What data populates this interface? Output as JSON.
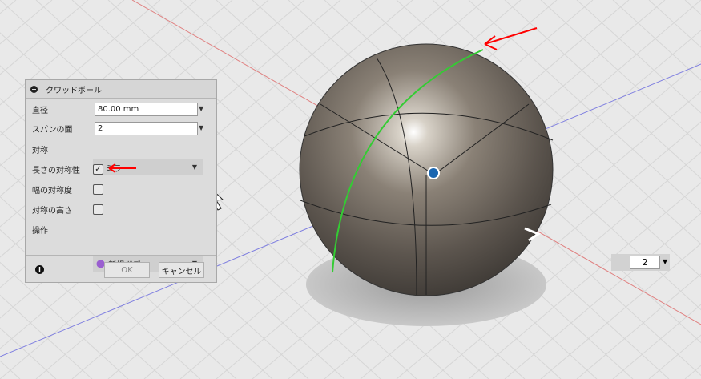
{
  "dialog": {
    "title": "クワッドボール",
    "fields": [
      {
        "label": "直径",
        "value": "80.00 mm"
      },
      {
        "label": "スパンの面",
        "value": "2"
      },
      {
        "label": "対称",
        "value": "ミラー"
      },
      {
        "label": "長さの対称性",
        "checked": true
      },
      {
        "label": "幅の対称度",
        "checked": false
      },
      {
        "label": "対称の高さ",
        "checked": false
      },
      {
        "label": "操作",
        "value": "新規ボディ"
      }
    ],
    "ok": "OK",
    "cancel": "キャンセル"
  },
  "viewport": {
    "spin_value": "2"
  },
  "colors": {
    "annotation": "#ff0000",
    "highlight_edge": "#33cc33"
  }
}
